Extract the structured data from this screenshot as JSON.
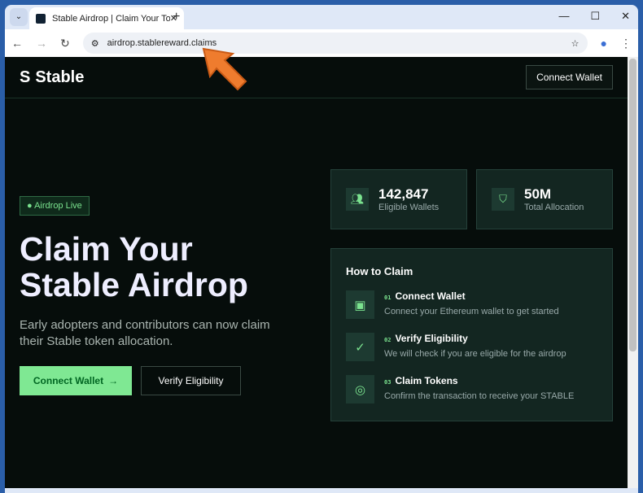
{
  "browser": {
    "tab_title": "Stable Airdrop | Claim Your Tokens",
    "url": "airdrop.stablereward.claims"
  },
  "header": {
    "logo": "Stable",
    "connect": "Connect Wallet"
  },
  "hero": {
    "badge": "Airdrop Live",
    "title1": "Claim Your",
    "title2": "Stable Airdrop",
    "subtitle": "Early adopters and contributors can now claim their Stable token allocation.",
    "cta": "Connect Wallet",
    "cta_arrow": "→",
    "secondary": "Verify Eligibility"
  },
  "stats": [
    {
      "value": "142,847",
      "label": "Eligible Wallets",
      "icon": "users-icon"
    },
    {
      "value": "50M",
      "label": "Total Allocation",
      "icon": "shield-icon"
    }
  ],
  "how": {
    "title": "How to Claim",
    "steps": [
      {
        "num": "01",
        "title": "Connect Wallet",
        "desc": "Connect your Ethereum wallet to get started",
        "icon": "wallet-icon"
      },
      {
        "num": "02",
        "title": "Verify Eligibility",
        "desc": "We will check if you are eligible for the airdrop",
        "icon": "check-circle-icon"
      },
      {
        "num": "03",
        "title": "Claim Tokens",
        "desc": "Confirm the transaction to receive your STABLE",
        "icon": "coins-icon"
      }
    ]
  }
}
